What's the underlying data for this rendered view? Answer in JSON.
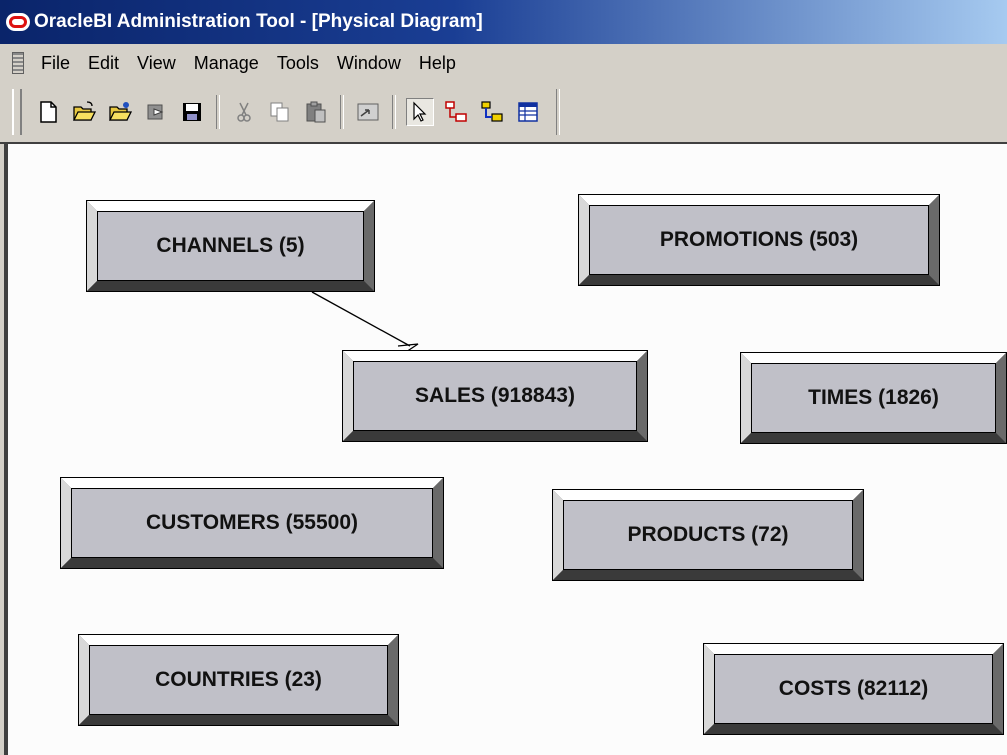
{
  "window": {
    "title": "OracleBI Administration Tool - [Physical Diagram]"
  },
  "menu": [
    "File",
    "Edit",
    "View",
    "Manage",
    "Tools",
    "Window",
    "Help"
  ],
  "toolbar": {
    "buttons": [
      "new-icon",
      "open-icon",
      "open-online-icon",
      "check-in-icon",
      "save-icon",
      "cut-icon",
      "copy-icon",
      "paste-icon",
      "diagram-icon",
      "select-pointer-icon",
      "new-join-icon",
      "new-complex-join-icon",
      "table-icon"
    ]
  },
  "diagram": {
    "tables": [
      {
        "id": "channels",
        "label": "CHANNELS (5)"
      },
      {
        "id": "promotions",
        "label": "PROMOTIONS (503)"
      },
      {
        "id": "sales",
        "label": "SALES (918843)"
      },
      {
        "id": "times",
        "label": "TIMES (1826)"
      },
      {
        "id": "customers",
        "label": "CUSTOMERS (55500)"
      },
      {
        "id": "products",
        "label": "PRODUCTS (72)"
      },
      {
        "id": "countries",
        "label": "COUNTRIES (23)"
      },
      {
        "id": "costs",
        "label": "COSTS (82112)"
      }
    ],
    "joins": [
      {
        "from": "channels",
        "to": "sales"
      }
    ]
  }
}
